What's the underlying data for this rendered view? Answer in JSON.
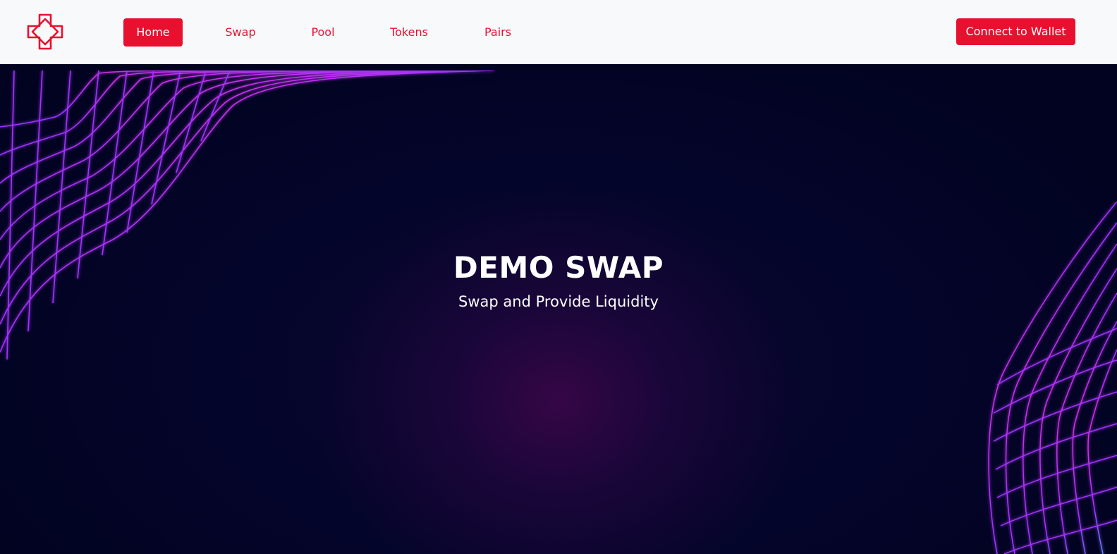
{
  "nav": {
    "items": [
      {
        "label": "Home",
        "active": true
      },
      {
        "label": "Swap",
        "active": false
      },
      {
        "label": "Pool",
        "active": false
      },
      {
        "label": "Tokens",
        "active": false
      },
      {
        "label": "Pairs",
        "active": false
      }
    ],
    "connect_label": "Connect to Wallet"
  },
  "hero": {
    "title": "DEMO SWAP",
    "subtitle": "Swap and Provide Liquidity"
  },
  "colors": {
    "accent": "#e8102f",
    "nav_bg": "#f8f9fb",
    "hero_bg": "#02031f",
    "wave_pink": "#ff2bd6",
    "wave_blue": "#4a4dff"
  },
  "icons": {
    "logo": "cross-logo-icon"
  }
}
